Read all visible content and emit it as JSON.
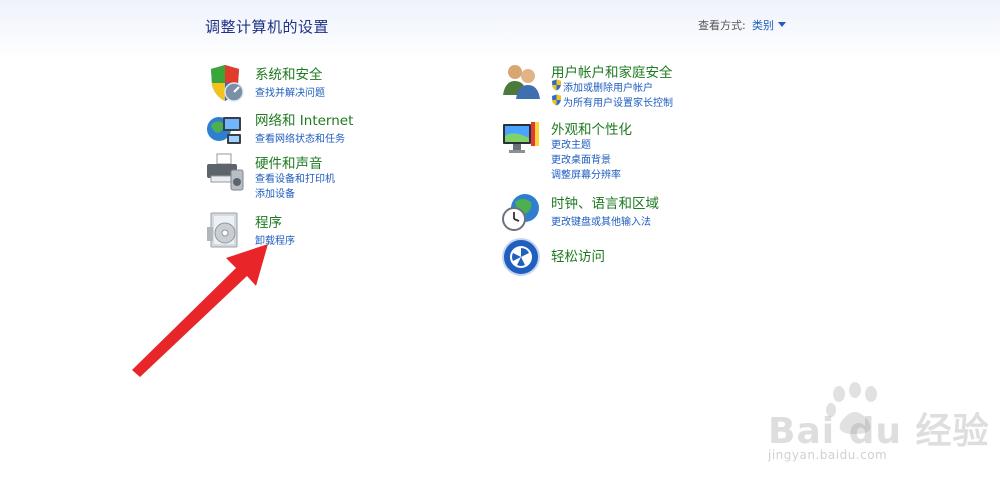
{
  "header": {
    "title": "调整计算机的设置",
    "view_by_label": "查看方式:",
    "view_by_value": "类别"
  },
  "left": [
    {
      "title": "系统和安全",
      "icon": "shield-security-icon",
      "links": [
        "查找并解决问题"
      ]
    },
    {
      "title": "网络和 Internet",
      "icon": "network-globe-icon",
      "links": [
        "查看网络状态和任务"
      ]
    },
    {
      "title": "硬件和声音",
      "icon": "printer-speaker-icon",
      "links": [
        "查看设备和打印机",
        "添加设备"
      ]
    },
    {
      "title": "程序",
      "icon": "programs-disc-icon",
      "links": [
        "卸载程序"
      ]
    }
  ],
  "right": [
    {
      "title": "用户帐户和家庭安全",
      "icon": "users-icon",
      "links": [
        "添加或删除用户帐户",
        "为所有用户设置家长控制"
      ]
    },
    {
      "title": "外观和个性化",
      "icon": "monitor-paint-icon",
      "links": [
        "更改主题",
        "更改桌面背景",
        "调整屏幕分辨率"
      ]
    },
    {
      "title": "时钟、语言和区域",
      "icon": "clock-globe-icon",
      "links": [
        "更改键盘或其他输入法"
      ]
    },
    {
      "title": "轻松访问",
      "icon": "ease-of-access-icon",
      "links": []
    }
  ],
  "watermark": {
    "logo_text": "Bai du 经验",
    "url_text": "jingyan.baidu.com"
  },
  "colors": {
    "title_blue": "#1e3287",
    "category_green": "#1e7a20",
    "link_blue": "#1e5cbf",
    "arrow_red": "#e8262a"
  }
}
